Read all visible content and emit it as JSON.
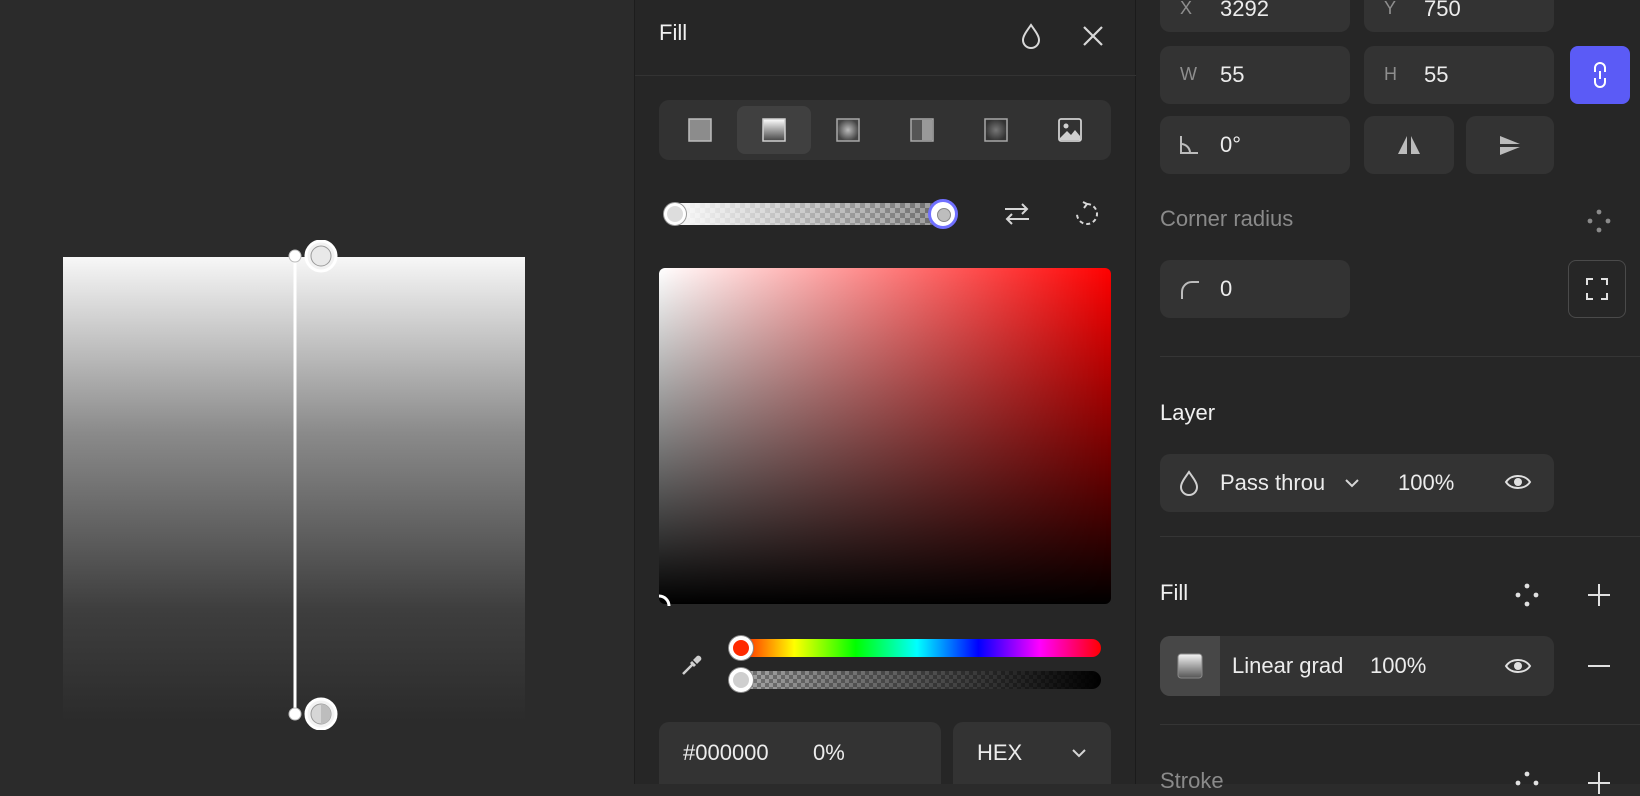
{
  "fill_popup": {
    "title": "Fill",
    "fill_types": [
      "solid",
      "linear-gradient",
      "radial-gradient",
      "angular-gradient",
      "diamond-gradient",
      "image"
    ],
    "active_fill_type": "linear-gradient",
    "color_value": "#000000",
    "opacity_value": "0%",
    "format_label": "HEX",
    "hue_fraction": 0.0,
    "alpha_fraction": 0.0
  },
  "transform": {
    "x_label": "X",
    "x_value": "3292",
    "y_label": "Y",
    "y_value": "750",
    "w_label": "W",
    "w_value": "55",
    "h_label": "H",
    "h_value": "55",
    "rotation_value": "0°"
  },
  "corner_radius": {
    "title": "Corner radius",
    "value": "0"
  },
  "layer": {
    "title": "Layer",
    "blend_mode": "Pass throu",
    "opacity": "100%"
  },
  "fill_section": {
    "title": "Fill",
    "item_name": "Linear grad",
    "item_opacity": "100%"
  },
  "stroke_section": {
    "title": "Stroke"
  },
  "colors": {
    "accent": "#5b5bf6",
    "panel_bg": "#262626",
    "canvas_bg": "#2b2b2b",
    "field_bg": "#333333"
  }
}
